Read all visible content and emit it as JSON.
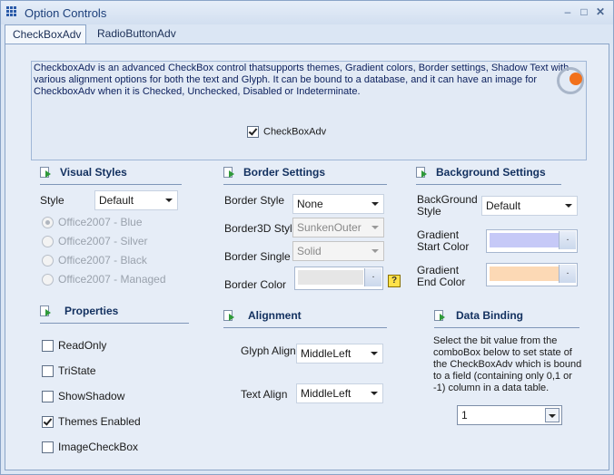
{
  "window": {
    "title": "Option Controls"
  },
  "tabs": [
    {
      "label": "CheckBoxAdv",
      "active": true
    },
    {
      "label": "RadioButtonAdv",
      "active": false
    }
  ],
  "description": {
    "text": "CheckboxAdv is an advanced CheckBox control thatsupports themes, Gradient colors, Border settings, Shadow Text with various alignment options for both the text and Glyph. It can be bound to a database, and it can have an image for CheckboxAdv when it is Checked, Unchecked, Disabled or Indeterminate.",
    "sample_checkbox_label": "CheckBoxAdv",
    "sample_checked": true
  },
  "visual_styles": {
    "title": "Visual Styles",
    "style_label": "Style",
    "style_value": "Default",
    "options": [
      "Office2007 - Blue",
      "Office2007 - Silver",
      "Office2007 - Black",
      "Office2007 - Managed"
    ]
  },
  "border_settings": {
    "title": "Border Settings",
    "border_style_label": "Border Style",
    "border_style_value": "None",
    "border3d_label": "Border3D Style",
    "border3d_value": "SunkenOuter",
    "border_single_label": "Border Single",
    "border_single_value": "Solid",
    "border_color_label": "Border Color",
    "border_color": "#e6e6e6",
    "help": "?"
  },
  "background_settings": {
    "title": "Background Settings",
    "bg_style_label": "BackGround Style",
    "bg_style_value": "Default",
    "grad_start_label": "Gradient Start Color",
    "grad_start_color": "#c6c9f7",
    "grad_end_label": "Gradient End Color",
    "grad_end_color": "#fcd9b5",
    "picker_glyph": "."
  },
  "properties": {
    "title": "Properties",
    "items": [
      {
        "label": "ReadOnly",
        "checked": false
      },
      {
        "label": "TriState",
        "checked": false
      },
      {
        "label": "ShowShadow",
        "checked": false
      },
      {
        "label": "Themes Enabled",
        "checked": true
      },
      {
        "label": "ImageCheckBox",
        "checked": false
      }
    ]
  },
  "alignment": {
    "title": "Alignment",
    "glyph_align_label": "Glyph Align",
    "glyph_align_value": "MiddleLeft",
    "text_align_label": "Text Align",
    "text_align_value": "MiddleLeft"
  },
  "data_binding": {
    "title": "Data Binding",
    "text": "Select the bit value from the comboBox below to set state of the CheckBoxAdv which is bound  to a field (containing only 0,1 or -1) column in a data table.",
    "value": "1"
  }
}
